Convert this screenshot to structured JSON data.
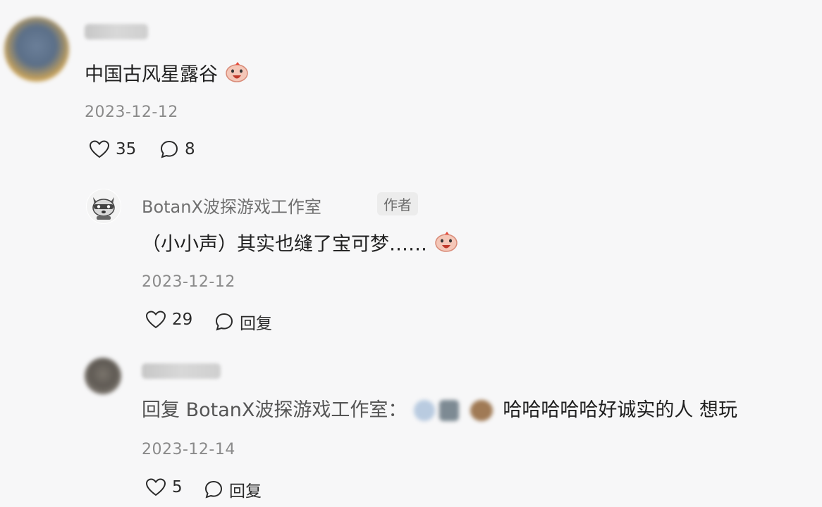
{
  "comment1": {
    "text": "中国古风星露谷",
    "date": "2023-12-12",
    "likes": "35",
    "replies": "8"
  },
  "reply1": {
    "author": "BotanX波探游戏工作室",
    "author_tag": "作者",
    "text": "（小小声）其实也缝了宝可梦……",
    "date": "2023-12-12",
    "likes": "29",
    "reply_label": "回复"
  },
  "reply2": {
    "prefix": "回复 BotanX波探游戏工作室：",
    "text": "哈哈哈哈哈好诚实的人 想玩",
    "date": "2023-12-14",
    "likes": "5",
    "reply_label": "回复"
  },
  "icons": {
    "like": "heart-outline-icon",
    "comment": "speech-bubble-icon",
    "emoji": "screaming-face-emoji"
  }
}
